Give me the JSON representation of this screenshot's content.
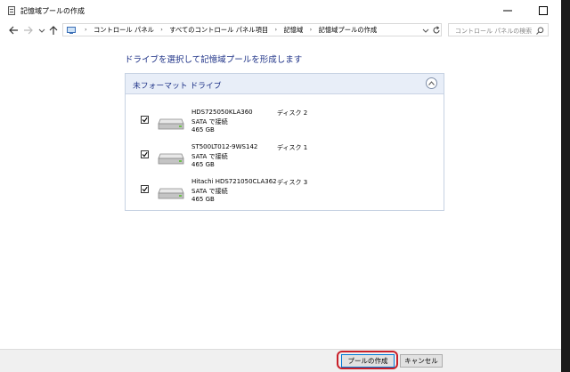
{
  "window": {
    "title": "記憶域プールの作成"
  },
  "address_bar": {
    "breadcrumbs": [
      "コントロール パネル",
      "すべてのコントロール パネル項目",
      "記憶域",
      "記憶域プールの作成"
    ],
    "separator": "›",
    "search_placeholder": "コントロール パネルの検索"
  },
  "main": {
    "heading": "ドライブを選択して記憶域プールを形成します",
    "section_title": "未フォーマット ドライブ",
    "drives": [
      {
        "name": "HDS725050KLA360",
        "bus": "SATA で接続",
        "size": "465 GB",
        "disk": "ディスク 2",
        "checked": true
      },
      {
        "name": "ST500LT012-9WS142",
        "bus": "SATA で接続",
        "size": "465 GB",
        "disk": "ディスク 1",
        "checked": true
      },
      {
        "name": "Hitachi HDS721050CLA362",
        "bus": "SATA で接続",
        "size": "465 GB",
        "disk": "ディスク 3",
        "checked": true
      }
    ]
  },
  "footer": {
    "create_label": "プールの作成",
    "cancel_label": "キャンセル"
  },
  "colors": {
    "accent_blue": "#1e3287",
    "section_header_bg": "#e8eef8",
    "highlight_red": "#c8202a"
  },
  "icons": {
    "app": "storage-spaces-icon",
    "back": "arrow-left-icon",
    "forward": "arrow-right-icon",
    "recent": "chevron-down-icon",
    "up": "arrow-up-icon",
    "refresh": "refresh-icon",
    "search": "search-icon",
    "drive": "hard-drive-icon",
    "collapse": "chevron-up-icon"
  }
}
